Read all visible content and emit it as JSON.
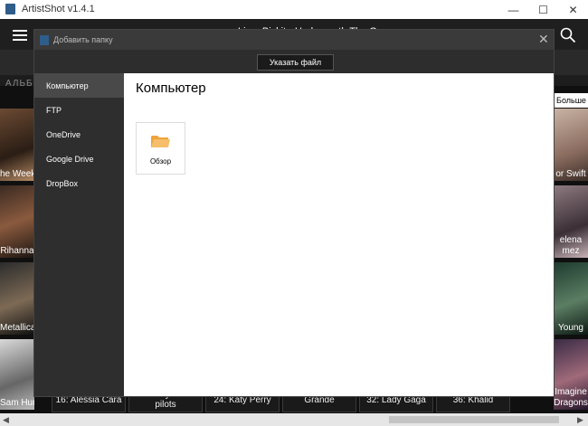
{
  "window": {
    "title": "ArtistShot v1.4.1",
    "buttons": {
      "minimize": "—",
      "maximize": "☐",
      "close": "✕"
    }
  },
  "header": {
    "now_playing": "Limp Bizkit - Underneath The Gun"
  },
  "tabs": {
    "albums": "АЛЬБО"
  },
  "grid": {
    "more_button": "Больше",
    "left_column": [
      "he Weeknd",
      "Rihanna",
      "Metallica",
      "Sam Hunt"
    ],
    "right_column": [
      "or Swift",
      "elena\nmez",
      "Young",
      "Imagine\nDragons"
    ],
    "bottom_row": [
      "16: Alessia Cara",
      "twenty one\npilots",
      "24: Katy Perry",
      "Grande",
      "32: Lady Gaga",
      "36: Khalid"
    ]
  },
  "dialog": {
    "title": "Добавить папку",
    "choose_file": "Указать файл",
    "sidebar": [
      {
        "label": "Компьютер",
        "selected": true
      },
      {
        "label": "FTP",
        "selected": false
      },
      {
        "label": "OneDrive",
        "selected": false
      },
      {
        "label": "Google Drive",
        "selected": false
      },
      {
        "label": "DropBox",
        "selected": false
      }
    ],
    "content_title": "Компьютер",
    "browse_label": "Обзор"
  },
  "colors": {
    "dialog_bg": "#2b2b2b",
    "selected_item": "#494949",
    "folder": "#f5a623"
  }
}
